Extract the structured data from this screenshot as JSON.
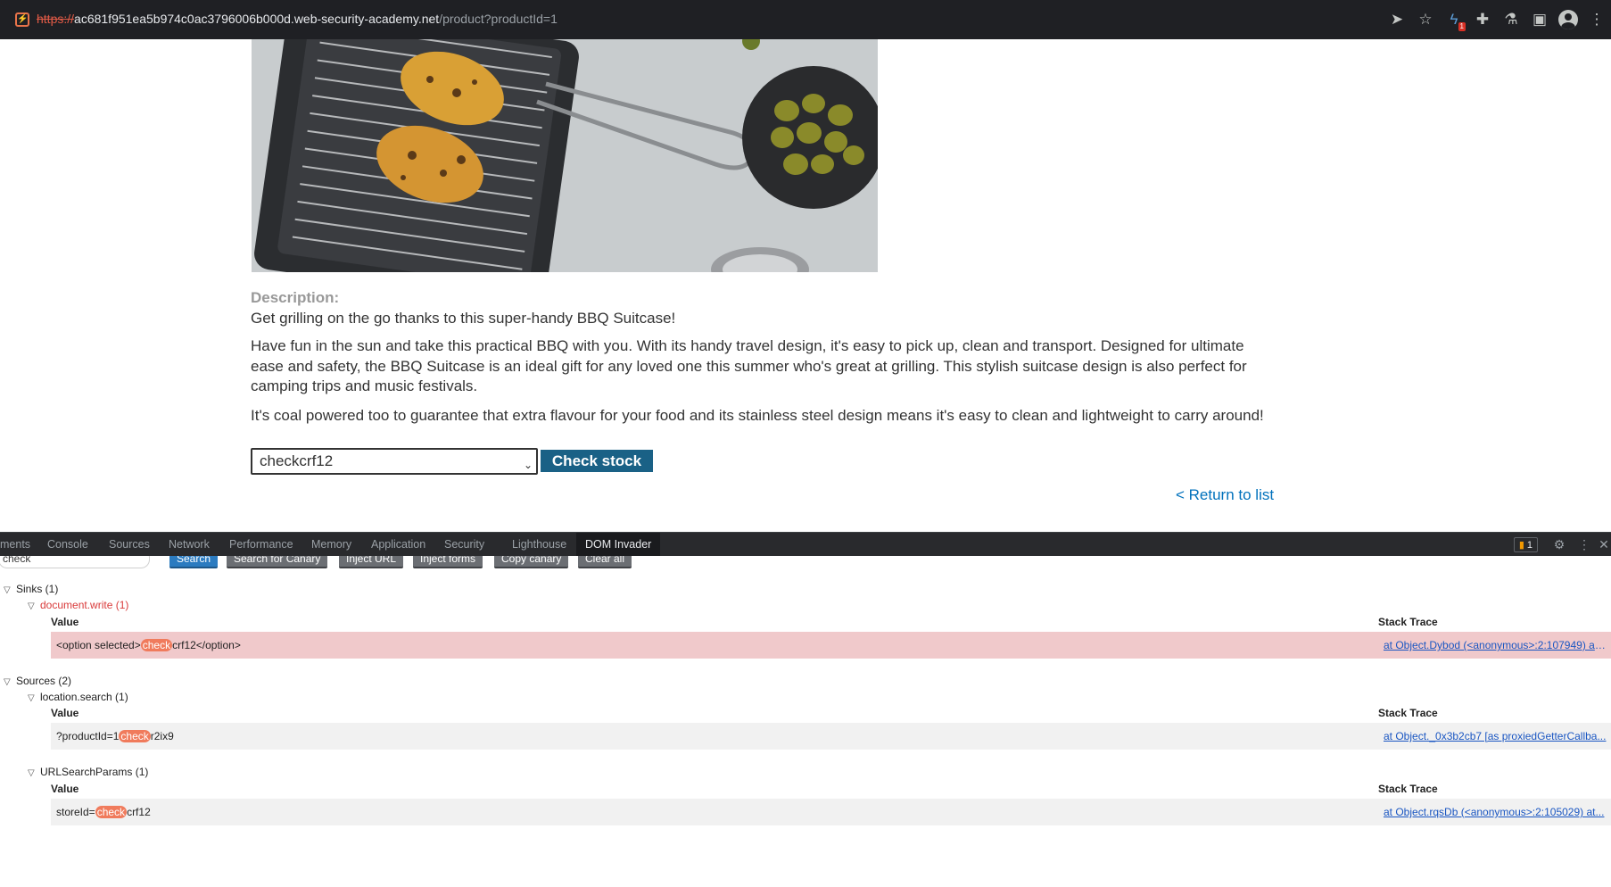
{
  "browser": {
    "url_scheme": "https://",
    "url_host": "ac681f951ea5b974c0ac3796006b000d.web-security-academy.net",
    "url_path": "/product?productId=1",
    "toolbar_icons": [
      "send-icon",
      "star-icon",
      "extension-badge-icon",
      "puzzle-icon",
      "lab-flask-icon",
      "sidebar-icon",
      "profile-icon"
    ],
    "extension_badge": "1"
  },
  "page": {
    "description_label": "Description:",
    "paragraphs": [
      "Get grilling on the go thanks to this super-handy BBQ Suitcase!",
      "Have fun in the sun and take this practical BBQ with you. With its handy travel design, it's easy to pick up, clean and transport. Designed for ultimate ease and safety, the BBQ Suitcase is an ideal gift for any loved one this summer who's great at grilling. This stylish suitcase design is also perfect for camping trips and music festivals.",
      "It's coal powered too to guarantee that extra flavour for your food and its stainless steel design means it's easy to clean and lightweight to carry around!"
    ],
    "store_select_value": "checkcrf12",
    "check_stock_label": "Check stock",
    "return_link": "< Return to list",
    "accent_color": "#1a6186"
  },
  "devtools": {
    "tabs": [
      "ments",
      "Console",
      "Sources",
      "Network",
      "Performance",
      "Memory",
      "Application",
      "Security",
      "Lighthouse",
      "DOM Invader"
    ],
    "active_tab": "DOM Invader",
    "issues_count": "1",
    "search_value": "check",
    "buttons": {
      "search": "Search",
      "search_canary": "Search for Canary",
      "inject_url": "Inject URL",
      "inject_forms": "Inject forms",
      "copy_canary": "Copy canary",
      "clear_all": "Clear all"
    },
    "sinks": {
      "label": "Sinks (1)",
      "group_label": "document.write (1)",
      "value_header": "Value",
      "trace_header": "Stack Trace",
      "rows": [
        {
          "pre": "<option selected>",
          "hl": "check",
          "post": "crf12</option>",
          "trace": "at Object.Dybod (<anonymous>:2:107949) at..."
        }
      ]
    },
    "sources": {
      "label": "Sources (2)",
      "groups": [
        {
          "label": "location.search (1)",
          "value_header": "Value",
          "trace_header": "Stack Trace",
          "rows": [
            {
              "pre": "?productId=1",
              "hl": "check",
              "post": "r2ix9",
              "trace": "at Object._0x3b2cb7 [as proxiedGetterCallba..."
            }
          ]
        },
        {
          "label": "URLSearchParams (1)",
          "value_header": "Value",
          "trace_header": "Stack Trace",
          "rows": [
            {
              "pre": "storeId=",
              "hl": "check",
              "post": "crf12",
              "trace": "at Object.rqsDb (<anonymous>:2:105029) at..."
            }
          ]
        }
      ]
    }
  }
}
